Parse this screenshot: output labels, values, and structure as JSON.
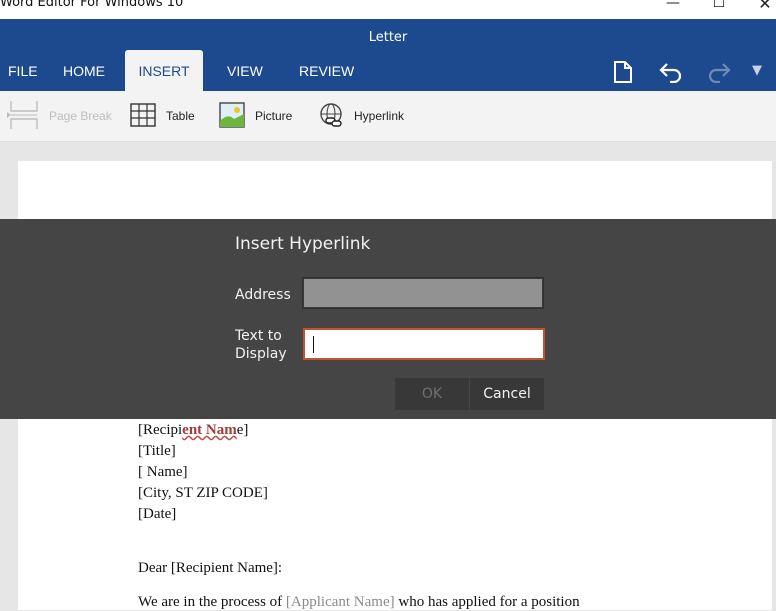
{
  "window": {
    "app_title": "Word Editor For Windows 10",
    "minimize_glyph": "—",
    "maximize_glyph": "☐",
    "close_glyph": "✕"
  },
  "ribbon": {
    "document_title": "Letter",
    "tabs": [
      {
        "label": "FILE"
      },
      {
        "label": "HOME"
      },
      {
        "label": "INSERT",
        "active": true
      },
      {
        "label": "VIEW"
      },
      {
        "label": "REVIEW"
      }
    ],
    "quick_actions": [
      "new-document-icon",
      "undo-icon",
      "redo-icon",
      "more-icon"
    ],
    "more_glyph": "▼",
    "accent_color": "#1d4a8f"
  },
  "toolbar": {
    "page_break_label": "Page Break",
    "table_label": "Table",
    "picture_label": "Picture",
    "hyperlink_label": "Hyperlink"
  },
  "dialog": {
    "title": "Insert Hyperlink",
    "address_label": "Address",
    "address_value": "",
    "display_label_line1": "Text to",
    "display_label_line2": "Display",
    "display_value": "",
    "ok_label": "OK",
    "cancel_label": "Cancel",
    "focus_border_color": "#c4522e"
  },
  "letter": {
    "recipient_prefix": "[Recipi",
    "recipient_flagged": "ent Nam",
    "recipient_suffix": "e]",
    "title_line": "[Title]",
    "name_line": "[  Name]",
    "city_line": "[City, ST ZIP CODE]",
    "date_line": "[Date]",
    "greeting": "Dear [Recipient Name]:",
    "body_start": "We are in the process of ",
    "body_placeholder": "[Applicant Name]",
    "body_end": " who has applied for a position"
  }
}
